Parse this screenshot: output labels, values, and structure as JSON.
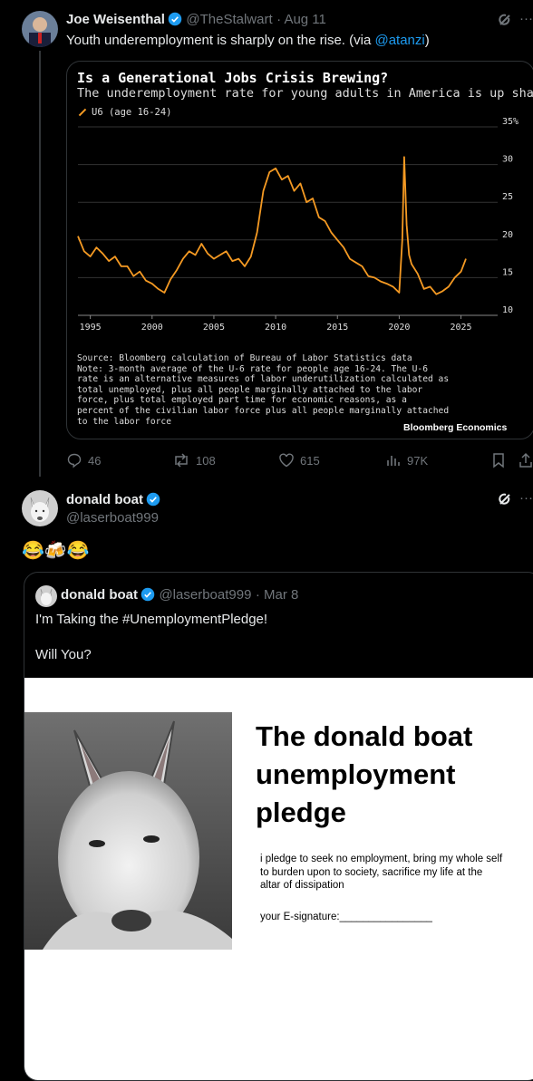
{
  "tweet1": {
    "author": "Joe Weisenthal",
    "handle": "@TheStalwart",
    "date": "· Aug 11",
    "text_before": "Youth underemployment is sharply on the rise. (via ",
    "mention": "@atanzi",
    "text_after": ")",
    "chart": {
      "title": "Is a Generational Jobs Crisis Brewing?",
      "subtitle": "The underemployment rate for young adults in America is up sharply",
      "legend": "U6 (age 16-24)",
      "source": [
        "Source: Bloomberg calculation of Bureau of Labor Statistics data",
        "Note: 3-month average of the U-6 rate for people age 16-24. The U-6",
        "rate is an alternative measures of labor underutilization calculated as",
        "total unemployed, plus all people marginally attached to the labor",
        "force, plus total employed part time for economic reasons, as a",
        "percent of the civilian labor force plus all people marginally attached",
        "to the labor force"
      ],
      "brand": "Bloomberg Economics"
    },
    "actions": {
      "replies": "46",
      "reposts": "108",
      "likes": "615",
      "views": "97K"
    }
  },
  "chart_data": {
    "type": "line",
    "title": "Is a Generational Jobs Crisis Brewing?",
    "subtitle": "The underemployment rate for young adults in America is up sharply",
    "ylim": [
      10,
      35
    ],
    "xlim": [
      1994,
      2026.5
    ],
    "y_ticks": [
      "35%",
      "30",
      "25",
      "20",
      "15",
      "10"
    ],
    "y_tick_values": [
      35,
      30,
      25,
      20,
      15,
      10
    ],
    "x_ticks": [
      "1995",
      "2000",
      "2005",
      "2010",
      "2015",
      "2020",
      "2025"
    ],
    "x_tick_values": [
      1995,
      2000,
      2005,
      2010,
      2015,
      2020,
      2025
    ],
    "series": [
      {
        "name": "U6 (age 16-24)",
        "color": "#f59a23",
        "x": [
          1994.0,
          1994.5,
          1995.0,
          1995.5,
          1996.0,
          1996.5,
          1997.0,
          1997.5,
          1998.0,
          1998.5,
          1999.0,
          1999.5,
          2000.0,
          2000.5,
          2001.0,
          2001.5,
          2002.0,
          2002.5,
          2003.0,
          2003.5,
          2004.0,
          2004.5,
          2005.0,
          2005.5,
          2006.0,
          2006.5,
          2007.0,
          2007.5,
          2008.0,
          2008.5,
          2009.0,
          2009.5,
          2010.0,
          2010.5,
          2011.0,
          2011.5,
          2012.0,
          2012.5,
          2013.0,
          2013.5,
          2014.0,
          2014.5,
          2015.0,
          2015.5,
          2016.0,
          2016.5,
          2017.0,
          2017.5,
          2018.0,
          2018.5,
          2019.0,
          2019.5,
          2020.0,
          2020.25,
          2020.4,
          2020.6,
          2020.8,
          2021.0,
          2021.5,
          2022.0,
          2022.5,
          2023.0,
          2023.5,
          2024.0,
          2024.5,
          2025.0,
          2025.4
        ],
        "values": [
          20.5,
          18.5,
          17.8,
          19.0,
          18.2,
          17.2,
          17.8,
          16.5,
          16.5,
          15.2,
          15.8,
          14.6,
          14.2,
          13.5,
          13.0,
          14.8,
          16.0,
          17.5,
          18.5,
          18.0,
          19.5,
          18.2,
          17.5,
          18.0,
          18.5,
          17.2,
          17.5,
          16.5,
          17.8,
          21.0,
          26.5,
          29.0,
          29.5,
          28.0,
          28.5,
          26.5,
          27.5,
          25.0,
          25.5,
          23.0,
          22.5,
          21.0,
          20.0,
          19.0,
          17.5,
          17.0,
          16.5,
          15.2,
          15.0,
          14.5,
          14.2,
          13.8,
          13.0,
          20.0,
          31.0,
          22.0,
          18.0,
          16.8,
          15.5,
          13.5,
          13.8,
          12.8,
          13.2,
          13.8,
          15.0,
          15.8,
          17.5
        ]
      }
    ]
  },
  "tweet2": {
    "author": "donald boat",
    "handle": "@laserboat999",
    "text": "😂🍻😂",
    "quote": {
      "author": "donald boat",
      "handle": "@laserboat999",
      "date": "· Mar 8",
      "line1": "I'm Taking the #UnemploymentPledge!",
      "line2": "Will You?",
      "pledge_title": [
        "The donald boat",
        "unemployment",
        "pledge"
      ],
      "pledge_body": [
        "i pledge to seek no employment, bring my whole self",
        "to burden upon to society, sacrifice my life at the",
        "altar of dissipation"
      ],
      "signature": "your E-signature:________________"
    }
  },
  "colors": {
    "accent": "#1d9bf0",
    "line": "#f59a23",
    "muted": "#71767b"
  }
}
